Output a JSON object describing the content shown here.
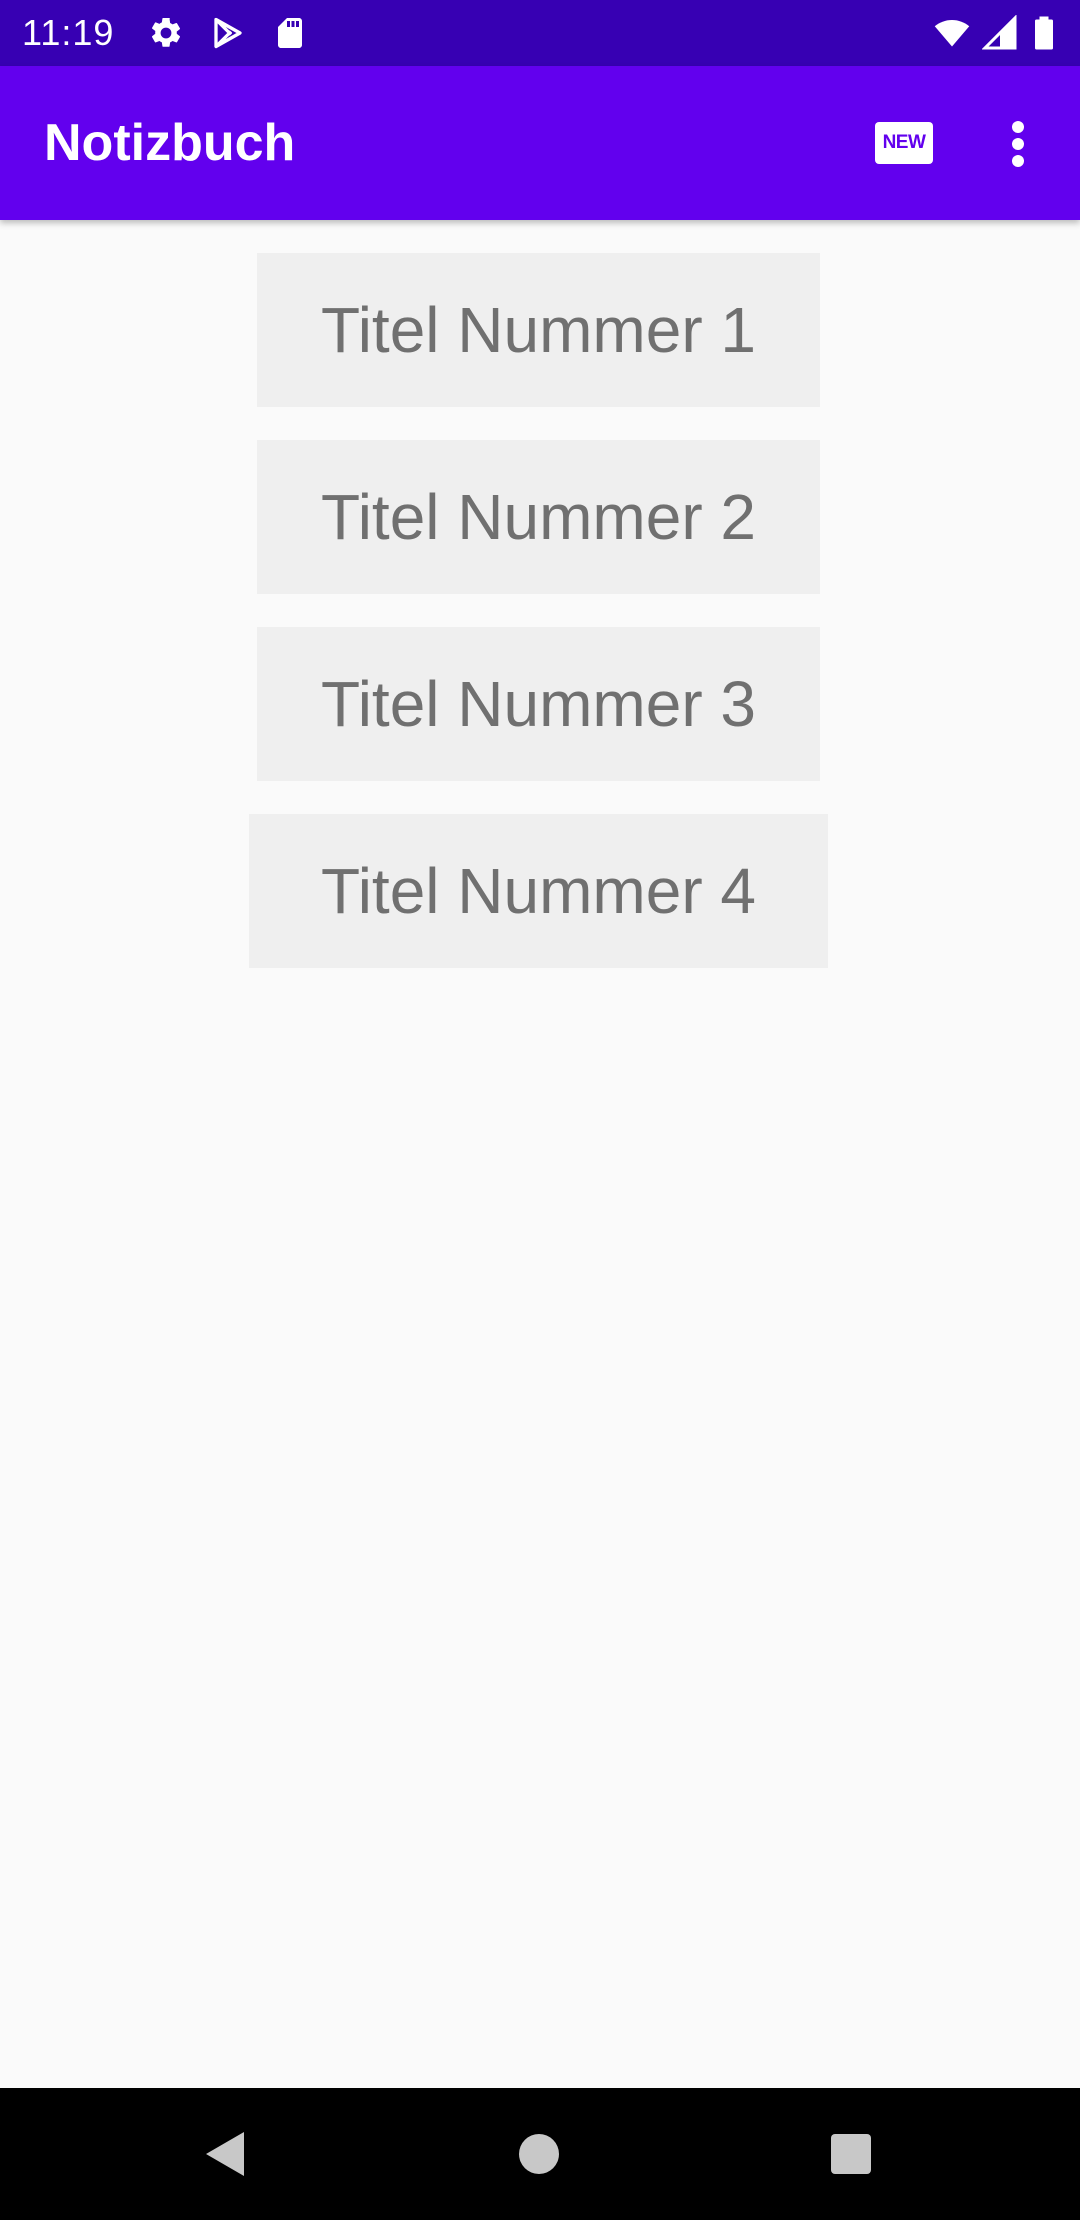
{
  "status_bar": {
    "time": "11:19",
    "icons": [
      "settings-icon",
      "play-store-icon",
      "sd-card-icon",
      "wifi-icon",
      "signal-icon",
      "battery-icon"
    ]
  },
  "app_bar": {
    "title": "Notizbuch",
    "new_label": "NEW",
    "overflow_icon": "more-vert-icon"
  },
  "notes": [
    {
      "title": "Titel Nummer 1"
    },
    {
      "title": "Titel Nummer 2"
    },
    {
      "title": "Titel Nummer 3"
    },
    {
      "title": "Titel Nummer 4"
    }
  ],
  "nav_bar": {
    "icons": [
      "back-icon",
      "home-icon",
      "recents-icon"
    ]
  },
  "colors": {
    "primary": "#6200EE",
    "primary_dark": "#3700B3",
    "background": "#FAFAFA",
    "note_button_bg": "#EFEFEF",
    "note_button_text": "#707070"
  }
}
